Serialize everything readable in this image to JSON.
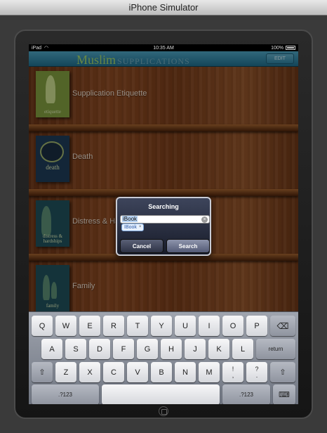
{
  "window": {
    "title": "iPhone Simulator"
  },
  "statusbar": {
    "carrier": "iPad",
    "time": "10:35 AM",
    "battery": "100%"
  },
  "navbar": {
    "logo_main": "Muslim",
    "logo_sub": "SUPPLICATIONS",
    "edit_label": "EDIT"
  },
  "books": [
    {
      "title": "Supplication Etiquette",
      "cover_text": "etiquette",
      "cover_color": "#7f9a3e"
    },
    {
      "title": "Death",
      "cover_text": "death",
      "cover_color": "#1e3b57"
    },
    {
      "title": "Distress & Hardships",
      "cover_text": "distress & hardships",
      "cover_color": "#1f4f5a"
    },
    {
      "title": "Family",
      "cover_text": "family",
      "cover_color": "#1f4f5a"
    }
  ],
  "alert": {
    "title": "Searching",
    "input_value": "iBook",
    "suggestion": "IBook",
    "cancel_label": "Cancel",
    "search_label": "Search"
  },
  "keyboard": {
    "row1": [
      "Q",
      "W",
      "E",
      "R",
      "T",
      "Y",
      "U",
      "I",
      "O",
      "P"
    ],
    "row2": [
      "A",
      "S",
      "D",
      "F",
      "G",
      "H",
      "J",
      "K",
      "L"
    ],
    "row3": [
      "Z",
      "X",
      "C",
      "V",
      "B",
      "N",
      "M"
    ],
    "return_label": "return",
    "numbers_label": ".?123",
    "excl_top": "!",
    "excl_bottom": ",",
    "q_top": "?",
    "q_bottom": "."
  }
}
